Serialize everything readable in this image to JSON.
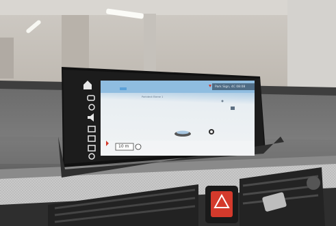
{
  "infotainment": {
    "status_bar": {
      "text": "Park Sign, 4C 08:08"
    },
    "map": {
      "scale_label": "10 m",
      "street_label": "Parkdeck Ebene 1"
    },
    "sidebar_icons": [
      "home-icon",
      "route-icon",
      "power-icon",
      "volume-icon",
      "media-icon",
      "contacts-icon",
      "map-icon",
      "settings-icon"
    ]
  },
  "colors": {
    "screen_sky": "#9ec6e6",
    "hazard": "#d43a2c"
  }
}
